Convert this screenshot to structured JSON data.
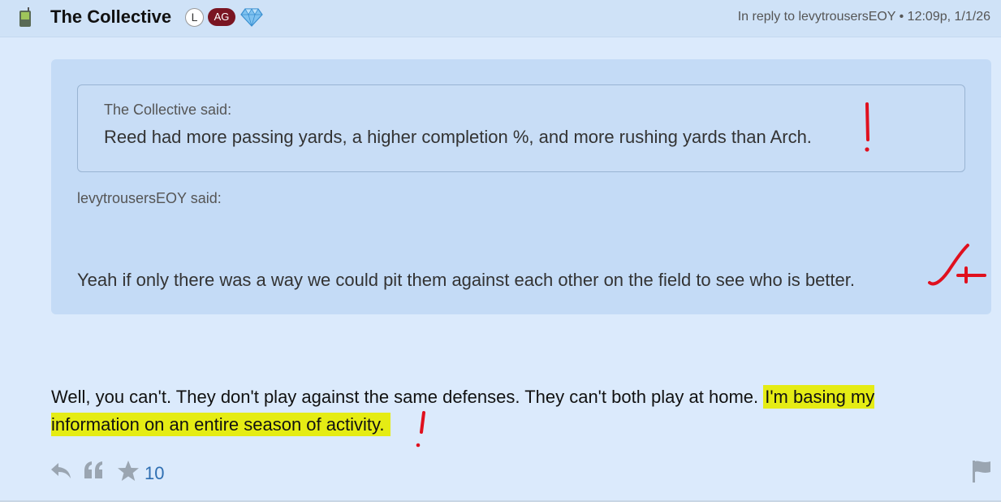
{
  "post": {
    "author": "The Collective",
    "badge_l": "L",
    "badge_ag": "AG",
    "reply_meta": "In reply to levytrousersEOY • 12:09p, 1/1/26"
  },
  "quote": {
    "inner_author": "The Collective said:",
    "inner_text": "Reed had more passing yards, a higher completion %, and more rushing yards than Arch.",
    "outer_author": "levytrousersEOY said:",
    "outer_text": "Yeah if only there was a way we could pit them against each other on the field to see who is better."
  },
  "body": {
    "text_plain": "Well, you can't. They don't play against the same defenses. They can't both play at home. ",
    "text_highlight": "I'm basing my information on an entire season of activity."
  },
  "actions": {
    "like_count": "10"
  },
  "colors": {
    "highlight": "#e5ec14",
    "annotation": "#e0101e",
    "badge_ag": "#7a1522",
    "like_count": "#2f6fb2"
  },
  "icons": [
    "device-icon",
    "gem-icon",
    "reply-icon",
    "quote-icon",
    "star-icon",
    "flag-icon"
  ]
}
